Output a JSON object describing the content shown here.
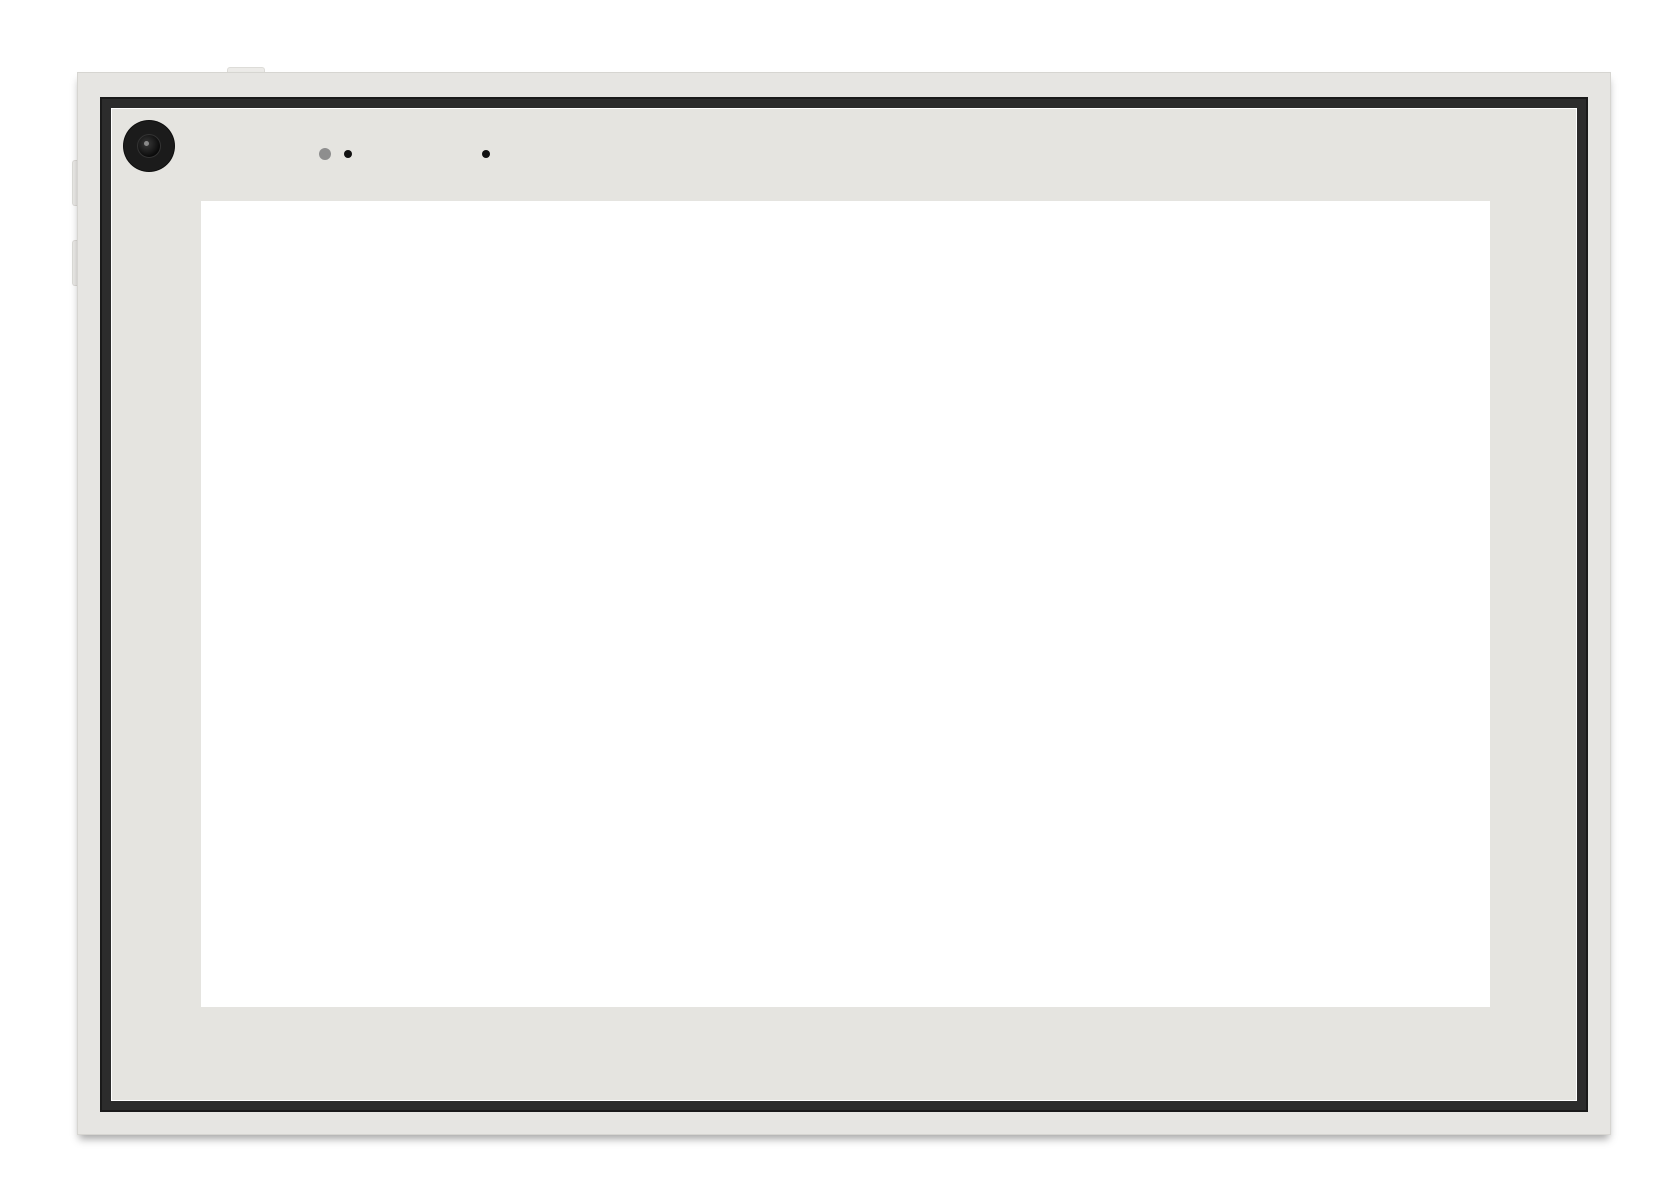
{
  "device": {
    "type": "tablet",
    "body_color": "#e6e5e2",
    "rim_color": "#2c2c2c",
    "screen_color": "#ffffff"
  },
  "hardware": {
    "camera_icon": "camera-lens-icon",
    "sensors": [
      "ambient-light-sensor-icon",
      "proximity-sensor-icon",
      "microphone-icon"
    ]
  },
  "screen": {
    "content": ""
  }
}
